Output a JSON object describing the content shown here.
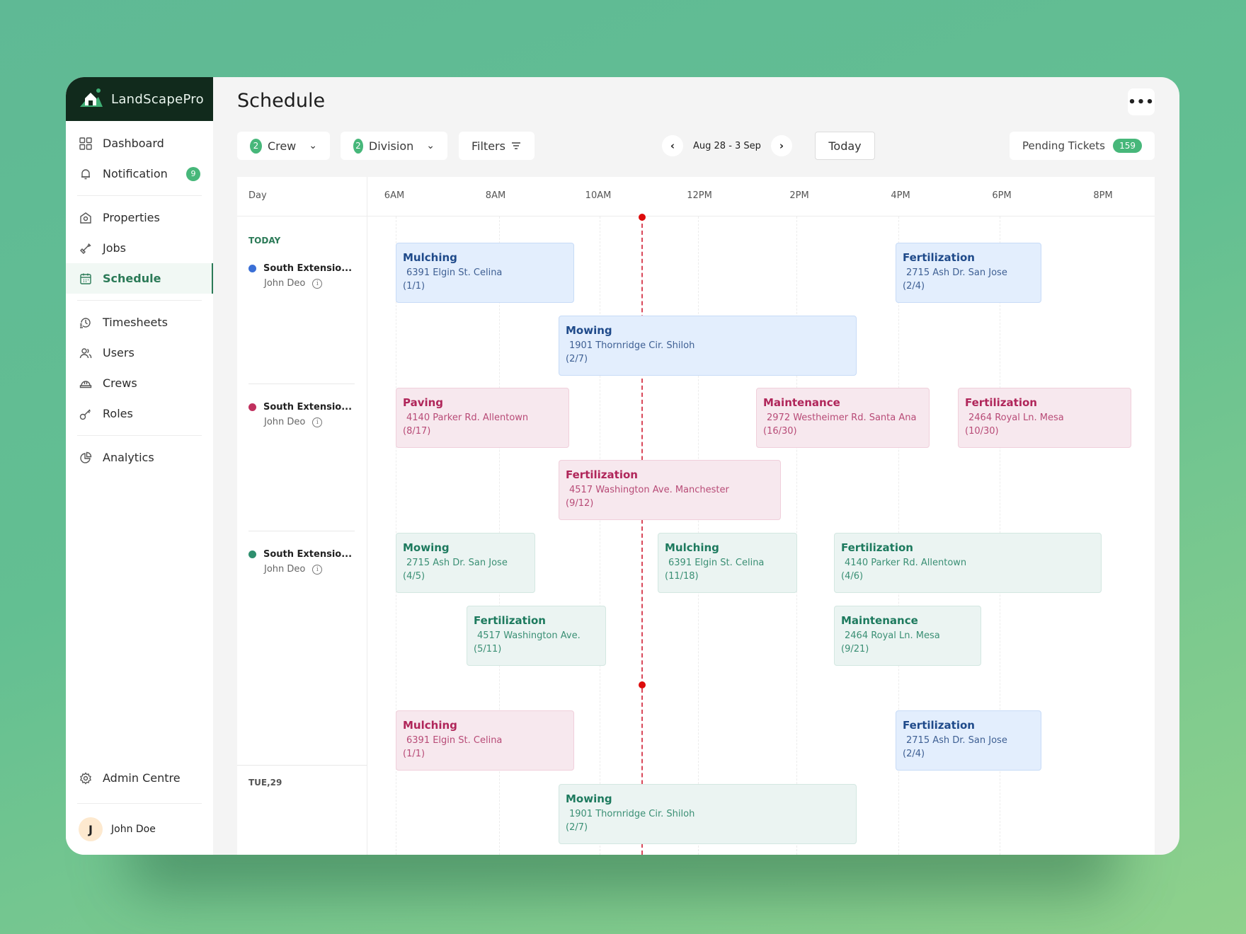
{
  "app": {
    "name": "LandScapePro"
  },
  "sidebar": {
    "items": [
      {
        "label": "Dashboard",
        "icon": "grid-icon"
      },
      {
        "label": "Notification",
        "icon": "bell-icon",
        "badge": "9"
      },
      {
        "label": "Properties",
        "icon": "property-icon"
      },
      {
        "label": "Jobs",
        "icon": "shovel-icon"
      },
      {
        "label": "Schedule",
        "icon": "calendar-icon",
        "active": true
      },
      {
        "label": "Timesheets",
        "icon": "history-icon"
      },
      {
        "label": "Users",
        "icon": "users-icon"
      },
      {
        "label": "Crews",
        "icon": "hardhat-icon"
      },
      {
        "label": "Roles",
        "icon": "key-icon"
      },
      {
        "label": "Analytics",
        "icon": "pie-chart-icon"
      }
    ],
    "admin": {
      "label": "Admin Centre",
      "icon": "gear-icon"
    },
    "user": {
      "initial": "J",
      "name": "John Doe"
    }
  },
  "header": {
    "title": "Schedule",
    "more": "•••"
  },
  "toolbar": {
    "crew": {
      "count": "2",
      "label": "Crew"
    },
    "division": {
      "count": "2",
      "label": "Division"
    },
    "filters": {
      "label": "Filters"
    },
    "date_range": "Aug 28 - 3 Sep",
    "today": "Today",
    "pending": {
      "label": "Pending Tickets",
      "count": "159"
    }
  },
  "schedule": {
    "day_header": "Day",
    "times": [
      "6AM",
      "8AM",
      "10AM",
      "12PM",
      "2PM",
      "4PM",
      "6PM",
      "8PM"
    ],
    "days": [
      {
        "label": "TODAY",
        "color": "#2b7a57"
      },
      {
        "label": "TUE,29",
        "color": "#555555"
      }
    ],
    "crews": [
      {
        "name": "South Extensio...",
        "lead": "John Deo",
        "color": "#3a6fd6"
      },
      {
        "name": "South Extensio...",
        "lead": "John Deo",
        "color": "#c0305e"
      },
      {
        "name": "South Extensio...",
        "lead": "John Deo",
        "color": "#2e8f6e"
      }
    ],
    "jobs": [
      {
        "title": "Mulching",
        "address": "6391 Elgin St. Celina",
        "count": "(1/1)",
        "color": "blue"
      },
      {
        "title": "Fertilization",
        "address": "2715 Ash Dr. San Jose",
        "count": "(2/4)",
        "color": "blue"
      },
      {
        "title": "Mowing",
        "address": "1901 Thornridge Cir. Shiloh",
        "count": "(2/7)",
        "color": "blue"
      },
      {
        "title": "Paving",
        "address": "4140 Parker Rd. Allentown",
        "count": "(8/17)",
        "color": "pink"
      },
      {
        "title": "Maintenance",
        "address": "2972 Westheimer Rd. Santa Ana",
        "count": "(16/30)",
        "color": "pink"
      },
      {
        "title": "Fertilization",
        "address": "2464 Royal Ln. Mesa",
        "count": "(10/30)",
        "color": "pink"
      },
      {
        "title": "Fertilization",
        "address": "4517 Washington Ave. Manchester",
        "count": "(9/12)",
        "color": "pink"
      },
      {
        "title": "Mowing",
        "address": "2715 Ash Dr. San Jose",
        "count": "(4/5)",
        "color": "green"
      },
      {
        "title": "Mulching",
        "address": "6391 Elgin St. Celina",
        "count": "(11/18)",
        "color": "green"
      },
      {
        "title": "Fertilization",
        "address": "4140 Parker Rd. Allentown",
        "count": "(4/6)",
        "color": "green"
      },
      {
        "title": "Fertilization",
        "address": "4517 Washington Ave.",
        "count": "(5/11)",
        "color": "green"
      },
      {
        "title": "Maintenance",
        "address": "2464 Royal Ln. Mesa",
        "count": "(9/21)",
        "color": "green"
      },
      {
        "title": "Mulching",
        "address": "6391 Elgin St. Celina",
        "count": "(1/1)",
        "color": "pink"
      },
      {
        "title": "Fertilization",
        "address": "2715 Ash Dr. San Jose",
        "count": "(2/4)",
        "color": "blue"
      },
      {
        "title": "Mowing",
        "address": "1901 Thornridge Cir. Shiloh",
        "count": "(2/7)",
        "color": "green"
      }
    ]
  }
}
